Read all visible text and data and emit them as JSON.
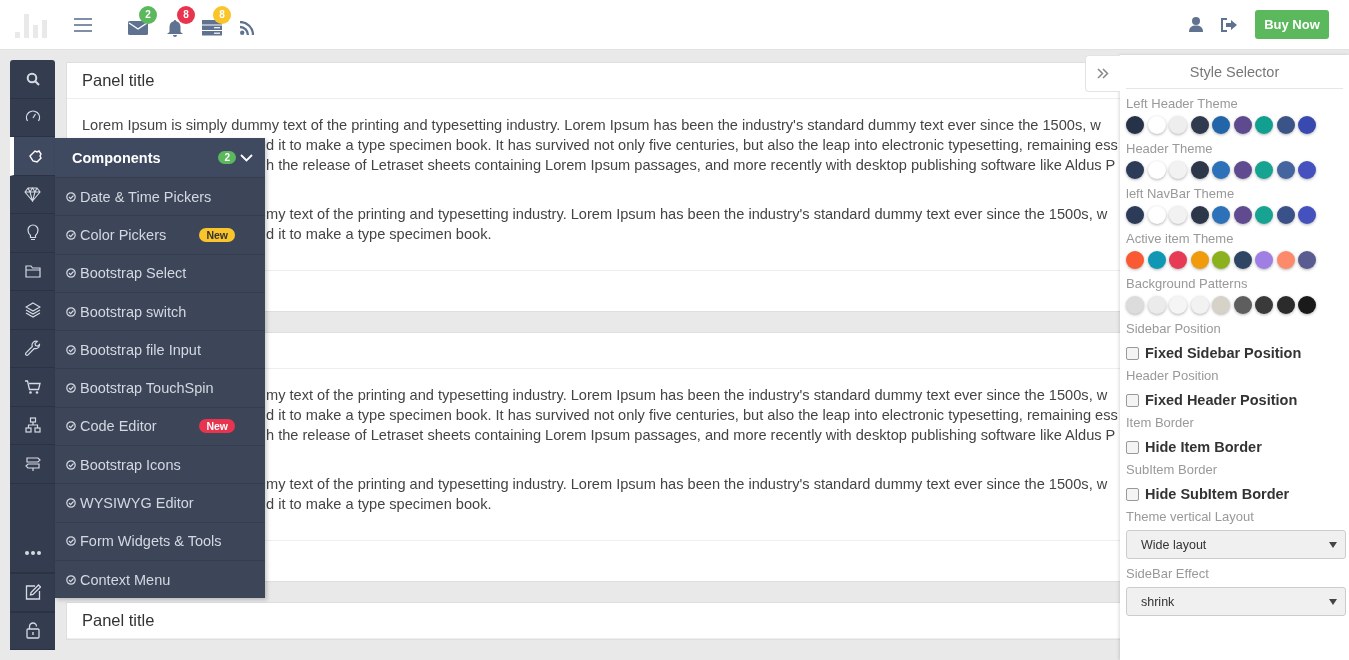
{
  "header": {
    "notifications": [
      {
        "count": "2",
        "color": "#5cb85c"
      },
      {
        "count": "8",
        "color": "#e8344e"
      },
      {
        "count": "8",
        "color": "#f9c52b"
      }
    ],
    "buy_button": "Buy Now"
  },
  "sidebar": {
    "items": [
      {
        "selected": false
      },
      {
        "selected": false
      },
      {
        "selected": true
      },
      {
        "selected": false
      },
      {
        "selected": false
      },
      {
        "selected": false
      },
      {
        "selected": false
      },
      {
        "selected": false
      },
      {
        "selected": false
      },
      {
        "selected": false
      },
      {
        "selected": false
      }
    ]
  },
  "submenu": {
    "title": "Components",
    "count": "2",
    "expanded": true,
    "items": [
      {
        "label": "Date & Time Pickers"
      },
      {
        "label": "Color Pickers",
        "badge": {
          "text": "New",
          "color": "#f9c52b"
        }
      },
      {
        "label": "Bootstrap Select"
      },
      {
        "label": "Bootstrap switch"
      },
      {
        "label": "Bootstrap file Input"
      },
      {
        "label": "Bootstrap TouchSpin"
      },
      {
        "label": "Code Editor",
        "badge": {
          "text": "New",
          "color": "#e8344e"
        }
      },
      {
        "label": "Bootstrap Icons"
      },
      {
        "label": "WYSIWYG Editor"
      },
      {
        "label": "Form Widgets & Tools"
      },
      {
        "label": "Context Menu"
      }
    ]
  },
  "panels": [
    {
      "title": "Panel title",
      "paragraphs": [
        [
          {
            "kind": "full",
            "text": "Lorem Ipsum is simply dummy text of the printing and typesetting industry. Lorem Ipsum has been the industry's standard dummy text ever since the 1500s, w"
          },
          {
            "kind": "tail",
            "text": "d it to make a type specimen book. It has survived not only five centuries, but also the leap into electronic typesetting, remaining ess"
          },
          {
            "kind": "tail",
            "text": "h the release of Letraset sheets containing Lorem Ipsum passages, and more recently with desktop publishing software like Aldus P"
          }
        ],
        [
          {
            "kind": "tail",
            "text": "my text of the printing and typesetting industry. Lorem Ipsum has been the industry's standard dummy text ever since the 1500s, w"
          },
          {
            "kind": "tail",
            "text": "d it to make a type specimen book."
          }
        ]
      ]
    },
    {
      "paragraphs": [
        [
          {
            "kind": "tail",
            "text": "my text of the printing and typesetting industry. Lorem Ipsum has been the industry's standard dummy text ever since the 1500s, w"
          },
          {
            "kind": "tail",
            "text": "d it to make a type specimen book. It has survived not only five centuries, but also the leap into electronic typesetting, remaining ess"
          },
          {
            "kind": "tail",
            "text": "h the release of Letraset sheets containing Lorem Ipsum passages, and more recently with desktop publishing software like Aldus P"
          }
        ],
        [
          {
            "kind": "tail",
            "text": "my text of the printing and typesetting industry. Lorem Ipsum has been the industry's standard dummy text ever since the 1500s, w"
          },
          {
            "kind": "tail",
            "text": "d it to make a type specimen book."
          }
        ]
      ]
    },
    {
      "title": "Panel title"
    }
  ],
  "style_selector": {
    "title": "Style Selector",
    "sections": [
      {
        "kind": "swatches",
        "label": "Left Header Theme",
        "swatches": [
          {
            "color": "#263248"
          },
          {
            "color": "#ffffff"
          },
          {
            "color": "#eeeeee"
          },
          {
            "color": "#303a4e"
          },
          {
            "color": "#2265a8"
          },
          {
            "color": "#5d4a8f"
          },
          {
            "color": "#11a08f"
          },
          {
            "color": "#3b5488"
          },
          {
            "color": "#3849b0"
          }
        ]
      },
      {
        "kind": "swatches",
        "label": "Header Theme",
        "swatches": [
          {
            "color": "#2c3b57"
          },
          {
            "color": "#ffffff"
          },
          {
            "color": "#f2f2f2"
          },
          {
            "color": "#2c374a"
          },
          {
            "color": "#2d72b8"
          },
          {
            "color": "#604b90"
          },
          {
            "color": "#16a391"
          },
          {
            "color": "#4465a0"
          },
          {
            "color": "#4552bd"
          }
        ]
      },
      {
        "kind": "swatches",
        "label": "left NavBar Theme",
        "swatches": [
          {
            "color": "#2c3b57"
          },
          {
            "color": "#ffffff"
          },
          {
            "color": "#f2f2f2"
          },
          {
            "color": "#2c374a"
          },
          {
            "color": "#2d72b8"
          },
          {
            "color": "#604b90"
          },
          {
            "color": "#16a391"
          },
          {
            "color": "#3a5088"
          },
          {
            "color": "#4552bd"
          }
        ]
      },
      {
        "kind": "swatches",
        "label": "Active item Theme",
        "swatches": [
          {
            "color": "#fa5a33"
          },
          {
            "color": "#1097b3"
          },
          {
            "color": "#e63a55"
          },
          {
            "color": "#f09b0c"
          },
          {
            "color": "#8bb11e"
          },
          {
            "color": "#2e4563"
          },
          {
            "color": "#9f7fe3"
          },
          {
            "color": "#fe8a6c"
          },
          {
            "color": "#585c91"
          }
        ]
      },
      {
        "kind": "swatches",
        "label": "Background Patterns",
        "swatches": [
          {
            "color": "#dcdcdc"
          },
          {
            "color": "#ebebeb"
          },
          {
            "color": "#f5f5f5"
          },
          {
            "color": "#f2f2f2"
          },
          {
            "color": "#d6d2c8"
          },
          {
            "color": "#5e5e5e"
          },
          {
            "color": "#3a3a3a"
          },
          {
            "color": "#2b2b2b"
          },
          {
            "color": "#1a1a1a"
          }
        ]
      },
      {
        "kind": "checkbox",
        "label": "Sidebar Position",
        "option": "Fixed Sidebar Position",
        "checked": false
      },
      {
        "kind": "checkbox",
        "label": "Header Position",
        "option": "Fixed Header Position",
        "checked": false
      },
      {
        "kind": "checkbox",
        "label": "Item Border",
        "option": "Hide Item Border",
        "checked": false
      },
      {
        "kind": "checkbox",
        "label": "SubItem Border",
        "option": "Hide SubItem Border",
        "checked": false
      },
      {
        "kind": "select",
        "label": "Theme vertical Layout",
        "value": "Wide layout"
      },
      {
        "kind": "select",
        "label": "SideBar Effect",
        "value": "shrink"
      }
    ]
  }
}
